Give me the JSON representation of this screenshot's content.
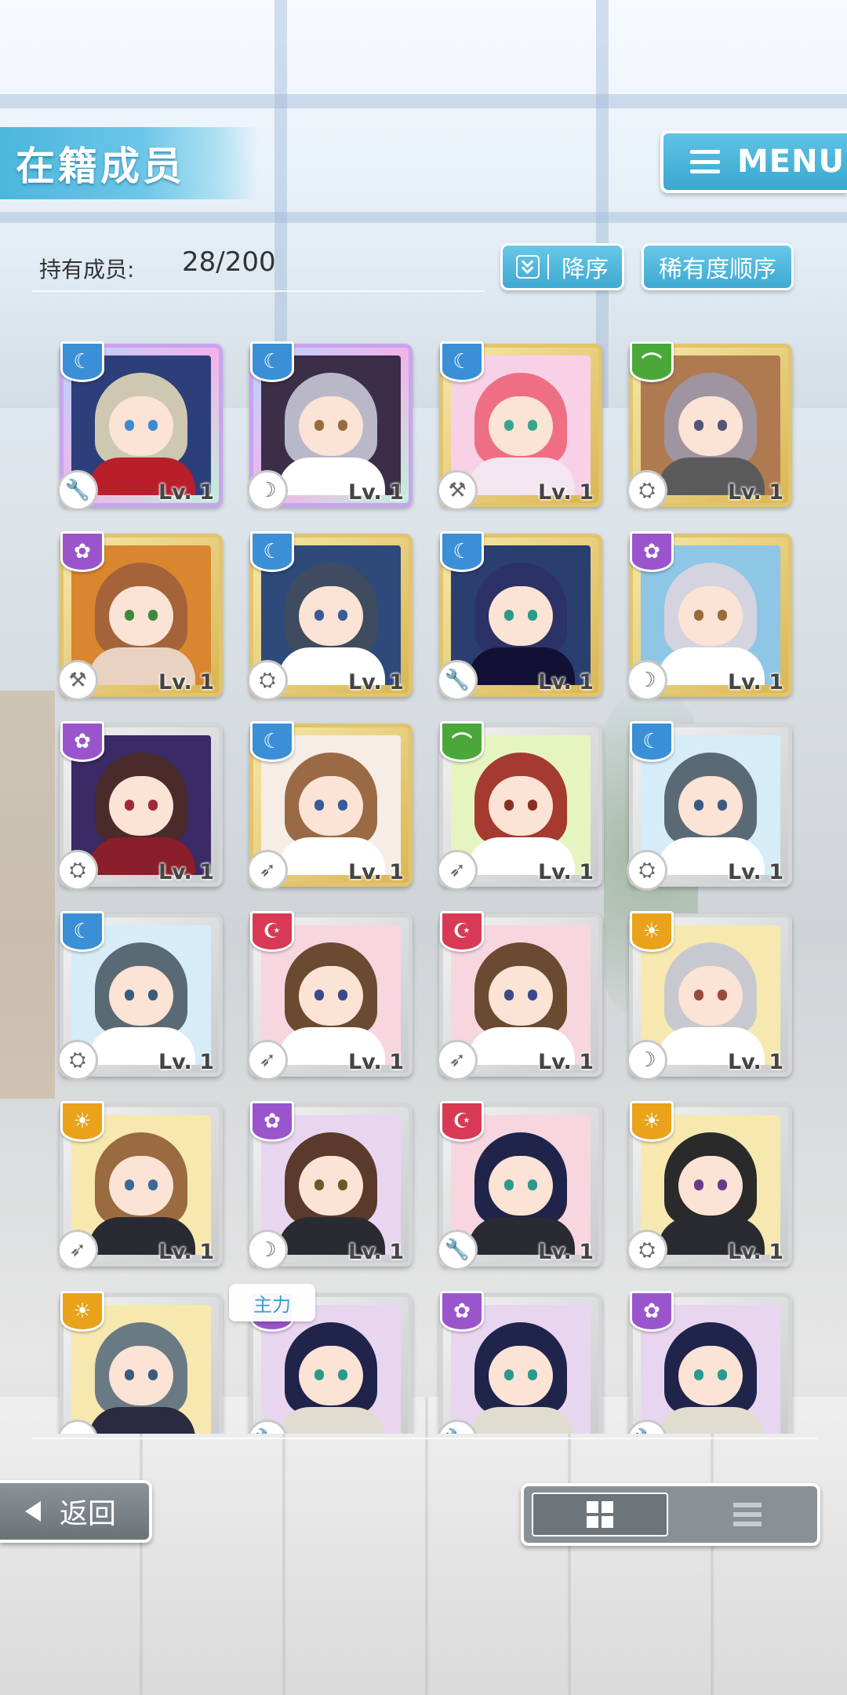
{
  "header": {
    "title": "在籍成员",
    "menu_label": "MENU"
  },
  "summary": {
    "count_label": "持有成员:",
    "count_value": "28/200"
  },
  "sort": {
    "order_label": "降序",
    "rarity_label": "稀有度顺序"
  },
  "cards": [
    {
      "level": "Lv. 1",
      "attribute": "blue",
      "frame": "rainbow",
      "hair": "#cfc8b0",
      "outfit": "#b81f2b",
      "bg": "#2d3f7a",
      "eyes": "#3f8ad0",
      "weapon_icon": "wrench-icon"
    },
    {
      "level": "Lv. 1",
      "attribute": "blue",
      "frame": "rainbow",
      "hair": "#b8b8c8",
      "outfit": "#ffffff",
      "bg": "#3c2e48",
      "eyes": "#9a6b3d",
      "weapon_icon": "scythe-icon"
    },
    {
      "level": "Lv. 1",
      "attribute": "blue",
      "frame": "gold",
      "hair": "#ee6f84",
      "outfit": "#f4e6f0",
      "bg": "#f7d1e6",
      "eyes": "#3aa58d",
      "weapon_icon": "hammer-icon"
    },
    {
      "level": "Lv. 1",
      "attribute": "green",
      "frame": "gold",
      "hair": "#9e95a0",
      "outfit": "#5a5a5a",
      "bg": "#b07a50",
      "eyes": "#555577",
      "weapon_icon": "shield-icon"
    },
    {
      "level": "Lv. 1",
      "attribute": "purple",
      "frame": "gold",
      "hair": "#a5633a",
      "outfit": "#e9d3c0",
      "bg": "#d9862f",
      "eyes": "#3f8a3a",
      "weapon_icon": "hammer-icon"
    },
    {
      "level": "Lv. 1",
      "attribute": "blue",
      "frame": "gold",
      "hair": "#3f4c5f",
      "outfit": "#ffffff",
      "bg": "#2e4a7a",
      "eyes": "#3a5a9a",
      "weapon_icon": "shield-icon"
    },
    {
      "level": "Lv. 1",
      "attribute": "blue",
      "frame": "gold",
      "hair": "#2c3166",
      "outfit": "#111133",
      "bg": "#2a3f70",
      "eyes": "#2a9a8a",
      "weapon_icon": "wrench-icon"
    },
    {
      "level": "Lv. 1",
      "attribute": "purple",
      "frame": "gold",
      "hair": "#d6d3e0",
      "outfit": "#ffffff",
      "bg": "#8ec6e6",
      "eyes": "#9a6b3d",
      "weapon_icon": "scythe-icon"
    },
    {
      "level": "Lv. 1",
      "attribute": "purple",
      "frame": "silver",
      "hair": "#4a2a2a",
      "outfit": "#8a1e2a",
      "bg": "#3a2a66",
      "eyes": "#a02a3a",
      "weapon_icon": "shield-icon"
    },
    {
      "level": "Lv. 1",
      "attribute": "blue",
      "frame": "gold",
      "hair": "#9a6a45",
      "outfit": "#ffffff",
      "bg": "#f5ede6",
      "eyes": "#3a5a9a",
      "weapon_icon": "spear-icon"
    },
    {
      "level": "Lv. 1",
      "attribute": "green",
      "frame": "silver",
      "hair": "#a53a30",
      "outfit": "#ffffff",
      "bg": "#e6f5c0",
      "eyes": "#8a3020",
      "weapon_icon": "spear-icon"
    },
    {
      "level": "Lv. 1",
      "attribute": "blue",
      "frame": "silver",
      "hair": "#5a6a75",
      "outfit": "#ffffff",
      "bg": "#d6ecf7",
      "eyes": "#3a5a80",
      "weapon_icon": "shield-icon"
    },
    {
      "level": "Lv. 1",
      "attribute": "blue",
      "frame": "silver",
      "hair": "#5a6a75",
      "outfit": "#ffffff",
      "bg": "#d6ecf7",
      "eyes": "#3a5a80",
      "weapon_icon": "shield-icon"
    },
    {
      "level": "Lv. 1",
      "attribute": "red",
      "frame": "silver",
      "hair": "#6a4a30",
      "outfit": "#ffffff",
      "bg": "#f7d6e0",
      "eyes": "#3a4a8a",
      "weapon_icon": "spear-icon"
    },
    {
      "level": "Lv. 1",
      "attribute": "red",
      "frame": "silver",
      "hair": "#6a4a30",
      "outfit": "#ffffff",
      "bg": "#f7d6e0",
      "eyes": "#3a4a8a",
      "weapon_icon": "spear-icon"
    },
    {
      "level": "Lv. 1",
      "attribute": "orange",
      "frame": "silver",
      "hair": "#c8c8d0",
      "outfit": "#ffffff",
      "bg": "#f7e8b0",
      "eyes": "#9a4a3a",
      "weapon_icon": "scythe-icon"
    },
    {
      "level": "Lv. 1",
      "attribute": "orange",
      "frame": "silver",
      "hair": "#9a6a40",
      "outfit": "#2a2a33",
      "bg": "#f7e8b0",
      "eyes": "#3a6a9a",
      "weapon_icon": "spear-icon"
    },
    {
      "level": "Lv. 1",
      "attribute": "purple",
      "frame": "silver",
      "hair": "#5a3a2a",
      "outfit": "#2a2a33",
      "bg": "#e8d6f0",
      "eyes": "#6a5a2a",
      "weapon_icon": "scythe-icon"
    },
    {
      "level": "Lv. 1",
      "attribute": "red",
      "frame": "silver",
      "hair": "#20244a",
      "outfit": "#2a2a33",
      "bg": "#f7d6e0",
      "eyes": "#2a9a8a",
      "weapon_icon": "wrench-icon"
    },
    {
      "level": "Lv. 1",
      "attribute": "orange",
      "frame": "silver",
      "hair": "#2a2a2a",
      "outfit": "#2a2a33",
      "bg": "#f7e8b0",
      "eyes": "#6a3a8a",
      "weapon_icon": "shield-icon"
    },
    {
      "level": "",
      "attribute": "orange",
      "frame": "silver",
      "hair": "#6a7a85",
      "outfit": "#2a2a40",
      "bg": "#f7e8b0",
      "eyes": "#3a5a80",
      "weapon_icon": "spear-icon"
    },
    {
      "level": "",
      "attribute": "purple",
      "frame": "silver",
      "hair": "#20244a",
      "outfit": "#e0dcd0",
      "bg": "#e8d6f0",
      "eyes": "#2a9a8a",
      "weapon_icon": "wrench-icon"
    },
    {
      "level": "",
      "attribute": "purple",
      "frame": "silver",
      "hair": "#20244a",
      "outfit": "#e0dcd0",
      "bg": "#e8d6f0",
      "eyes": "#2a9a8a",
      "weapon_icon": "wrench-icon"
    },
    {
      "level": "",
      "attribute": "purple",
      "frame": "silver",
      "hair": "#20244a",
      "outfit": "#e0dcd0",
      "bg": "#e8d6f0",
      "eyes": "#2a9a8a",
      "weapon_icon": "wrench-icon"
    }
  ],
  "lead_tag": "主力",
  "footer": {
    "back_label": "返回",
    "view_mode": "grid"
  }
}
